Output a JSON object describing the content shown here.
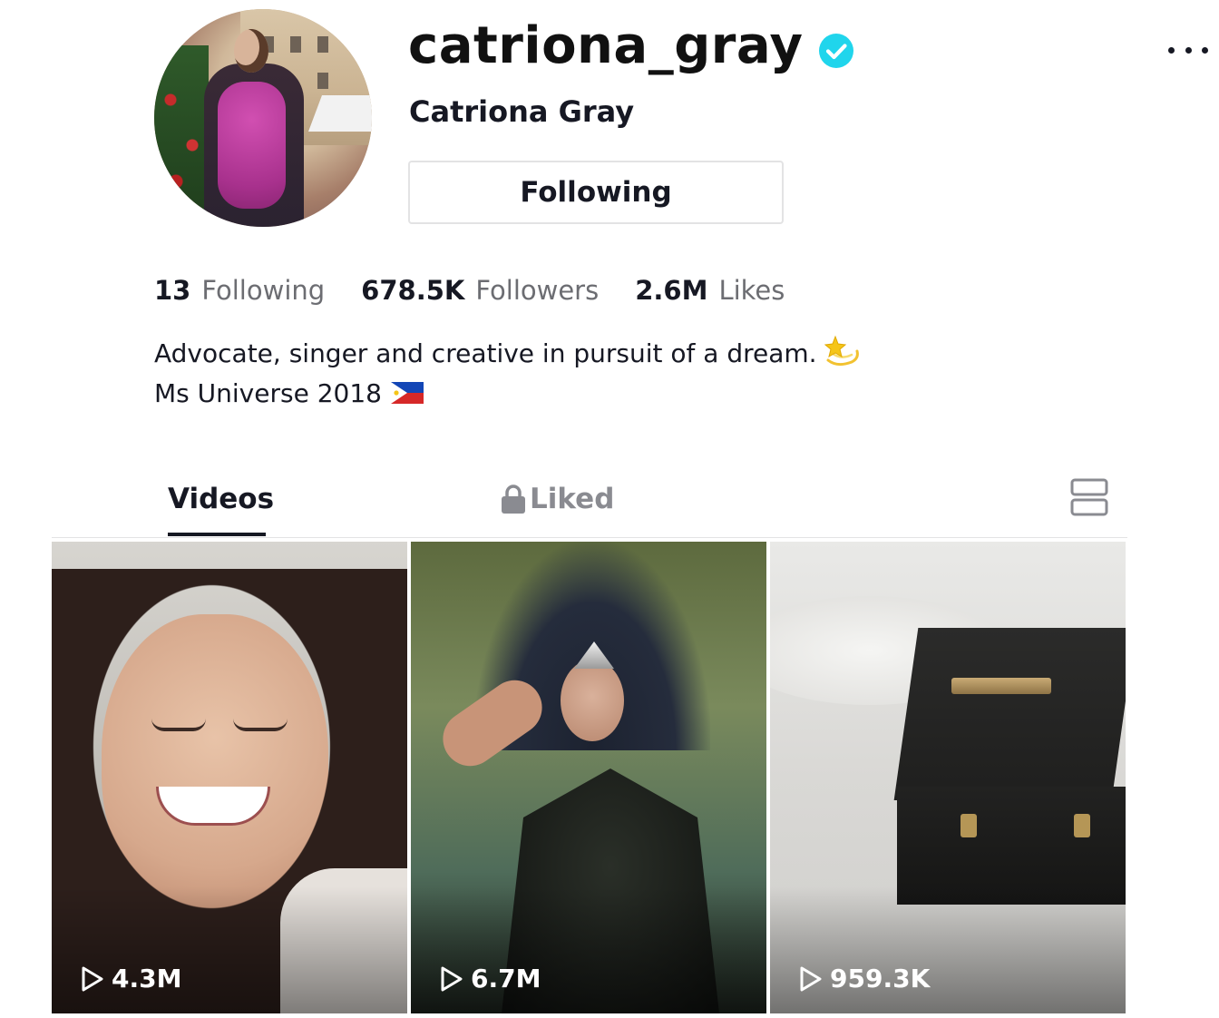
{
  "profile": {
    "username": "catriona_gray",
    "display_name": "Catriona Gray",
    "verified": true,
    "follow_button_label": "Following",
    "more_icon": "more-horizontal-icon"
  },
  "stats": {
    "following_count": "13",
    "following_label": "Following",
    "followers_count": "678.5K",
    "followers_label": "Followers",
    "likes_count": "2.6M",
    "likes_label": "Likes"
  },
  "bio": {
    "line1": "Advocate, singer and creative in pursuit of a dream.",
    "line2": "Ms Universe 2018"
  },
  "tabs": [
    {
      "label": "Videos",
      "active": true
    },
    {
      "label": "Liked",
      "locked": true,
      "active": false
    }
  ],
  "videos": [
    {
      "views": "4.3M"
    },
    {
      "views": "6.7M"
    },
    {
      "views": "959.3K"
    }
  ],
  "colors": {
    "verified_badge": "#20d5ec",
    "text_primary": "#161823",
    "text_secondary": "#6c6d72"
  }
}
